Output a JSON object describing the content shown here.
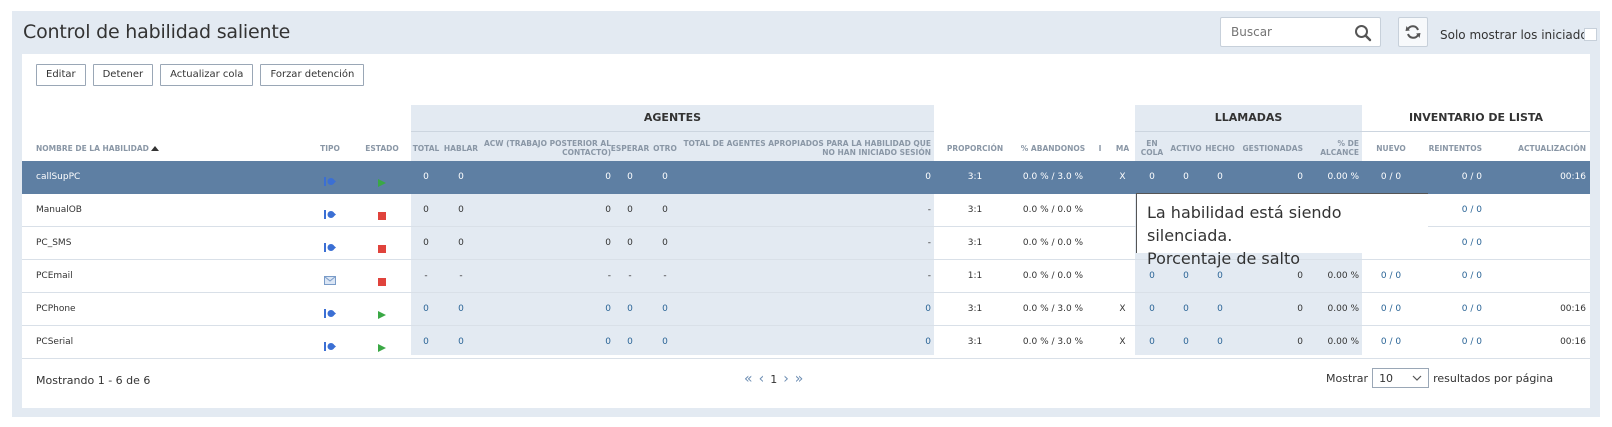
{
  "page": {
    "title": "Control de habilidad saliente",
    "search_placeholder": "Buscar",
    "only_started_label": "Solo mostrar los iniciados"
  },
  "toolbar": {
    "edit": "Editar",
    "stop": "Detener",
    "update_queue": "Actualizar cola",
    "force_stop": "Forzar detención"
  },
  "groups": {
    "agents": "AGENTES",
    "calls": "LLAMADAS",
    "inventory": "INVENTARIO DE LISTA"
  },
  "headers": {
    "name": "NOMBRE DE LA HABILIDAD",
    "type": "TIPO",
    "state": "ESTADO",
    "total": "TOTAL",
    "talk": "HABLAR",
    "acw": "ACW (TRABAJO POSTERIOR AL CONTACTO)",
    "wait": "ESPERAR",
    "other": "OTRO",
    "total_not_logged": "TOTAL DE AGENTES APROPIADOS PARA LA HABILIDAD QUE NO HAN INICIADO SESIÓN",
    "ratio": "PROPORCIÓN",
    "abandons": "% ABANDONOS",
    "i": "I",
    "ma": "MA",
    "queue": "EN COLA",
    "active": "ACTIVO",
    "done": "HECHO",
    "handled": "GESTIONADAS",
    "reach": "% DE ALCANCE",
    "new": "NUEVO",
    "retries": "REINTENTOS",
    "update": "ACTUALIZACIÓN"
  },
  "rows": [
    {
      "name": "callSupPC",
      "type_icon": "phone-outbound-icon",
      "state_icon": "running-icon",
      "total": "0",
      "talk": "0",
      "acw": "0",
      "wait": "0",
      "other": "0",
      "total_not_logged": "0",
      "ratio": "3:1",
      "abandons": "0.0 % / 3.0 %",
      "i": "",
      "ma": "X",
      "queue": "0",
      "active": "0",
      "done": "0",
      "handled": "0",
      "reach": "0.00 %",
      "new": "0 / 0",
      "retries": "0 / 0",
      "update": "00:16",
      "selected": true
    },
    {
      "name": "ManualOB",
      "type_icon": "phone-outbound-icon",
      "state_icon": "stopped-icon",
      "total": "0",
      "talk": "0",
      "acw": "0",
      "wait": "0",
      "other": "0",
      "total_not_logged": "-",
      "ratio": "3:1",
      "abandons": "0.0 % / 0.0 %",
      "i": "",
      "ma": "",
      "queue": "",
      "active": "",
      "done": "",
      "handled": "",
      "reach": "",
      "new": "",
      "retries": "0 / 0",
      "update": ""
    },
    {
      "name": "PC_SMS",
      "type_icon": "phone-outbound-icon",
      "state_icon": "stopped-icon",
      "total": "0",
      "talk": "0",
      "acw": "0",
      "wait": "0",
      "other": "0",
      "total_not_logged": "-",
      "ratio": "3:1",
      "abandons": "0.0 % / 0.0 %",
      "i": "",
      "ma": "",
      "queue": "",
      "active": "",
      "done": "",
      "handled": "",
      "reach": "",
      "new": "",
      "retries": "0 / 0",
      "update": ""
    },
    {
      "name": "PCEmail",
      "type_icon": "email-icon",
      "state_icon": "stopped-icon",
      "total": "-",
      "talk": "-",
      "acw": "-",
      "wait": "-",
      "other": "-",
      "total_not_logged": "-",
      "ratio": "1:1",
      "abandons": "0.0 % / 0.0 %",
      "i": "",
      "ma": "",
      "queue": "0",
      "active": "0",
      "done": "0",
      "handled": "0",
      "reach": "0.00 %",
      "new": "0 / 0",
      "retries": "0 / 0",
      "update": ""
    },
    {
      "name": "PCPhone",
      "type_icon": "phone-outbound-icon",
      "state_icon": "running-icon",
      "total": "0",
      "talk": "0",
      "acw": "0",
      "wait": "0",
      "other": "0",
      "total_not_logged": "0",
      "ratio": "3:1",
      "abandons": "0.0 % / 3.0 %",
      "i": "",
      "ma": "X",
      "queue": "0",
      "active": "0",
      "done": "0",
      "handled": "0",
      "reach": "0.00 %",
      "new": "0 / 0",
      "retries": "0 / 0",
      "update": "00:16"
    },
    {
      "name": "PCSerial",
      "type_icon": "phone-outbound-icon",
      "state_icon": "running-icon",
      "total": "0",
      "talk": "0",
      "acw": "0",
      "wait": "0",
      "other": "0",
      "total_not_logged": "0",
      "ratio": "3:1",
      "abandons": "0.0 % / 3.0 %",
      "i": "",
      "ma": "X",
      "queue": "0",
      "active": "0",
      "done": "0",
      "handled": "0",
      "reach": "0.00 %",
      "new": "0 / 0",
      "retries": "0 / 0",
      "update": "00:16"
    }
  ],
  "tooltip": {
    "line1": "La habilidad está siendo silenciada.",
    "line2": "Porcentaje de salto"
  },
  "footer": {
    "showing": "Mostrando 1 - 6 de 6",
    "page": "1",
    "show_label": "Mostrar",
    "page_size": "10",
    "results_label": "resultados por página"
  },
  "colors": {
    "selected_row": "#5e7fa3",
    "group_bg": "#e3eaf2",
    "link": "#2a6496",
    "running": "#3aa845",
    "stopped": "#e0433c"
  }
}
